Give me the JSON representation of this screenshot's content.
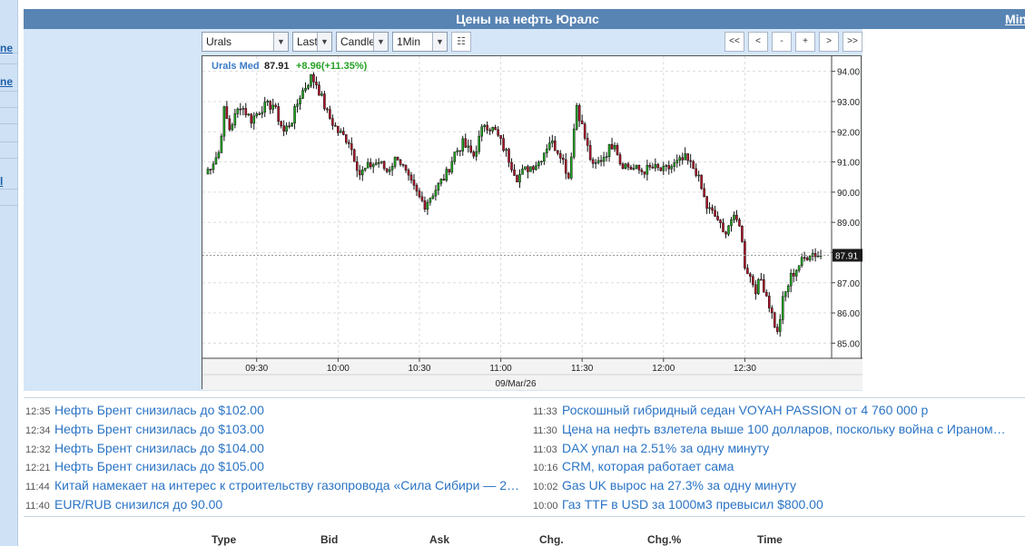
{
  "title_bar": {
    "title": "Цены на нефть Юралс",
    "links": [
      "Min",
      "M"
    ],
    "separator": "|"
  },
  "left_strip": {
    "links": [
      "ne",
      "ne",
      "l"
    ]
  },
  "toolbar": {
    "symbol": "Urals",
    "price_type": "Last",
    "chart_type": "Candle",
    "interval": "1Min",
    "nav_buttons": [
      "<<",
      "<",
      "-",
      "+",
      ">",
      ">>"
    ]
  },
  "chart_legend": {
    "name": "Urals Med",
    "price": "87.91",
    "change": "+8.96(+11.35%)"
  },
  "chart_data": {
    "type": "candlestick",
    "date_label": "09/Mar/26",
    "x_ticks": [
      "09:30",
      "10:00",
      "10:30",
      "11:00",
      "11:30",
      "12:00",
      "12:30"
    ],
    "y_ticks": [
      "94.00",
      "93.00",
      "92.00",
      "91.00",
      "90.00",
      "89.00",
      "88.00",
      "87.00",
      "86.00",
      "85.00"
    ],
    "ylim": [
      84.5,
      94.5
    ],
    "last_price_label": "87.91",
    "up_color": "#1fa81f",
    "down_color": "#b3122a",
    "close_path": [
      [
        "09:11",
        90.6
      ],
      [
        "09:16",
        91.3
      ],
      [
        "09:18",
        92.7
      ],
      [
        "09:20",
        92.1
      ],
      [
        "09:24",
        92.9
      ],
      [
        "09:28",
        92.4
      ],
      [
        "09:32",
        92.8
      ],
      [
        "09:36",
        92.9
      ],
      [
        "09:40",
        92.0
      ],
      [
        "09:43",
        92.4
      ],
      [
        "09:46",
        93.2
      ],
      [
        "09:50",
        93.8
      ],
      [
        "09:52",
        93.6
      ],
      [
        "09:56",
        92.6
      ],
      [
        "10:00",
        92.0
      ],
      [
        "10:04",
        91.7
      ],
      [
        "10:08",
        90.6
      ],
      [
        "10:12",
        90.9
      ],
      [
        "10:15",
        91.0
      ],
      [
        "10:18",
        90.7
      ],
      [
        "10:22",
        91.2
      ],
      [
        "10:26",
        90.4
      ],
      [
        "10:30",
        89.8
      ],
      [
        "10:32",
        89.6
      ],
      [
        "10:36",
        90.1
      ],
      [
        "10:40",
        90.6
      ],
      [
        "10:43",
        91.3
      ],
      [
        "10:46",
        91.6
      ],
      [
        "10:50",
        91.2
      ],
      [
        "10:54",
        92.3
      ],
      [
        "10:58",
        92.0
      ],
      [
        "11:02",
        91.3
      ],
      [
        "11:06",
        90.5
      ],
      [
        "11:10",
        90.8
      ],
      [
        "11:14",
        91.0
      ],
      [
        "11:18",
        91.7
      ],
      [
        "11:22",
        91.3
      ],
      [
        "11:25",
        90.5
      ],
      [
        "11:28",
        92.9
      ],
      [
        "11:31",
        91.8
      ],
      [
        "11:34",
        90.8
      ],
      [
        "11:38",
        91.2
      ],
      [
        "11:42",
        91.7
      ],
      [
        "11:44",
        91.0
      ],
      [
        "11:48",
        90.8
      ],
      [
        "11:52",
        90.7
      ],
      [
        "11:56",
        90.8
      ],
      [
        "12:00",
        90.7
      ],
      [
        "12:04",
        90.9
      ],
      [
        "12:08",
        91.1
      ],
      [
        "12:12",
        90.7
      ],
      [
        "12:16",
        89.5
      ],
      [
        "12:20",
        89.1
      ],
      [
        "12:22",
        88.6
      ],
      [
        "12:25",
        89.1
      ],
      [
        "12:28",
        89.0
      ],
      [
        "12:30",
        87.6
      ],
      [
        "12:34",
        86.8
      ],
      [
        "12:36",
        87.1
      ],
      [
        "12:38",
        86.6
      ],
      [
        "12:42",
        85.3
      ],
      [
        "12:44",
        86.4
      ],
      [
        "12:47",
        87.2
      ],
      [
        "12:50",
        87.6
      ],
      [
        "12:54",
        88.0
      ],
      [
        "12:58",
        87.9
      ]
    ]
  },
  "news": {
    "left": [
      {
        "time": "12:35",
        "title": "Нефть Брент снизилась до $102.00"
      },
      {
        "time": "12:34",
        "title": "Нефть Брент снизилась до $103.00"
      },
      {
        "time": "12:32",
        "title": "Нефть Брент снизилась до $104.00"
      },
      {
        "time": "12:21",
        "title": "Нефть Брент снизилась до $105.00"
      },
      {
        "time": "11:44",
        "title": "Китай намекает на интерес к строительству газопровода «Сила Сибири — 2…"
      },
      {
        "time": "11:40",
        "title": "EUR/RUB снизился до 90.00"
      }
    ],
    "right": [
      {
        "time": "11:33",
        "title": "Роскошный гибридный седан VOYAH PASSION от 4 760 000 р"
      },
      {
        "time": "11:30",
        "title": "Цена на нефть взлетела выше 100 долларов, поскольку война с Ираном…"
      },
      {
        "time": "11:03",
        "title": "DAX упал на 2.51% за одну минуту"
      },
      {
        "time": "10:16",
        "title": "CRM, которая работает сама"
      },
      {
        "time": "10:02",
        "title": "Gas UK вырос на 27.3% за одну минуту"
      },
      {
        "time": "10:00",
        "title": "Газ TTF в USD за 1000м3 превысил $800.00"
      }
    ]
  },
  "table_headers": [
    "Type",
    "Bid",
    "Ask",
    "Chg.",
    "Chg.%",
    "Time"
  ]
}
